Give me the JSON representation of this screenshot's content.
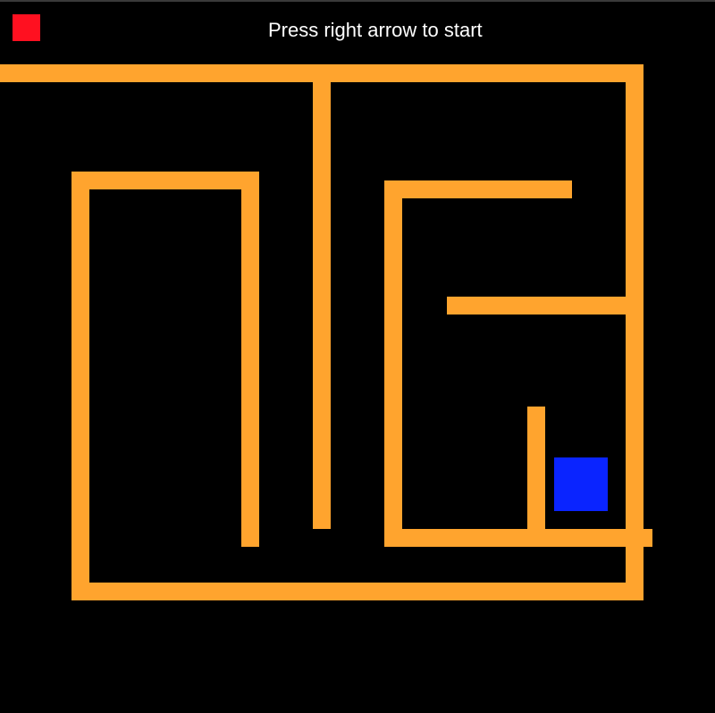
{
  "hud": {
    "status_text": "Press right arrow to start"
  },
  "colors": {
    "background": "#000000",
    "wall": "#FFA42E",
    "player": "#0A24FF",
    "indicator": "#FF1020",
    "text": "#FFFFFF"
  },
  "game": {
    "maze_wall_count": 12,
    "player_label": "player-square",
    "indicator_label": "red-status-square"
  }
}
